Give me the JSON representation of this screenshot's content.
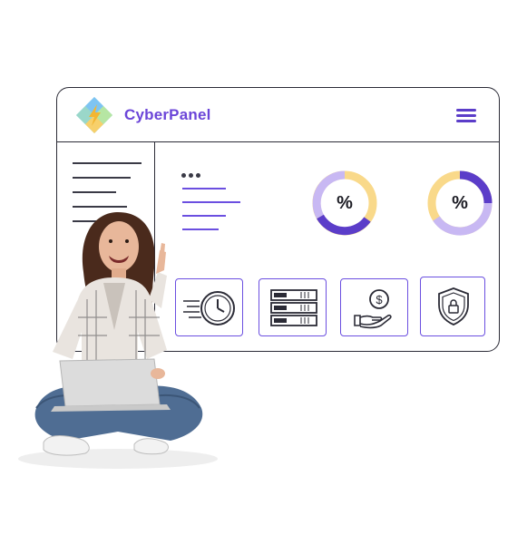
{
  "app": {
    "brand": "CyberPanel"
  },
  "header": {
    "menu_icon": "hamburger-menu-icon"
  },
  "stats": [
    {
      "label": "%",
      "segments": [
        0.55,
        0.45
      ],
      "colors": [
        "#c8b8f3",
        "#5b3dc9"
      ],
      "ring": "#f9d98a"
    },
    {
      "label": "%",
      "segments": [
        0.5,
        0.5
      ],
      "colors": [
        "#c8b8f3",
        "#5b3dc9"
      ],
      "ring": "#f9d98a"
    }
  ],
  "tiles": [
    {
      "icon": "fast-clock-icon"
    },
    {
      "icon": "server-rack-icon"
    },
    {
      "icon": "money-hand-icon"
    },
    {
      "icon": "shield-lock-icon"
    }
  ],
  "colors": {
    "accent": "#6b4fe0",
    "brand": "#6b45d8",
    "donut_light": "#c8b8f3",
    "donut_dark": "#5b3dc9",
    "donut_yellow": "#f9d98a"
  }
}
